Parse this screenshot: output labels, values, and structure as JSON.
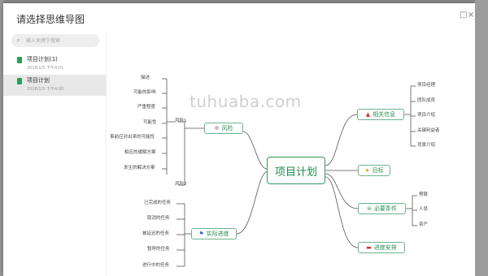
{
  "dialog": {
    "title": "请选择思维导图"
  },
  "window_controls": {
    "maximize": "□",
    "close": "×"
  },
  "search": {
    "placeholder": "输入关键字搜索"
  },
  "files": [
    {
      "name": "项目计划(1)",
      "date": "2018/1/5  下午4:01",
      "selected": false
    },
    {
      "name": "项目计划",
      "date": "2018/1/5  下午4:00",
      "selected": true
    }
  ],
  "watermark": "tuhuaba.com",
  "mindmap": {
    "root": "项目计划",
    "risk": {
      "label": "风险",
      "icon": "⊕",
      "sub1": "风险1",
      "sub2": "风险2",
      "leaves": [
        "描述",
        "可能的影响",
        "严重程度",
        "可能性",
        "事前应对出来的可能性",
        "相应的缓解方案",
        "发生的解决方案"
      ]
    },
    "progress": {
      "label": "实际进度",
      "icon": "⚑",
      "leaves": [
        "已完成的任务",
        "取消的任务",
        "被延迟的任务",
        "暂停的任务",
        "进行中的任务"
      ]
    },
    "info": {
      "label": "相关信息",
      "icon": "▲",
      "leaves": [
        "项目经理",
        "团队成员",
        "项目介绍",
        "关键利益者",
        "背景介绍"
      ]
    },
    "goal": {
      "label": "目标",
      "icon": "★"
    },
    "conditions": {
      "label": "必要条件",
      "icon": "⊜",
      "leaves": [
        "预算",
        "人员",
        "资产"
      ]
    },
    "schedule": {
      "label": "进度安排",
      "icon": "▬"
    }
  },
  "colors": {
    "accent": "#2f9b58",
    "node_border": "#6db48a",
    "warning": "#d9342b",
    "star": "#f0a020",
    "flag": "#2a6fd6"
  }
}
